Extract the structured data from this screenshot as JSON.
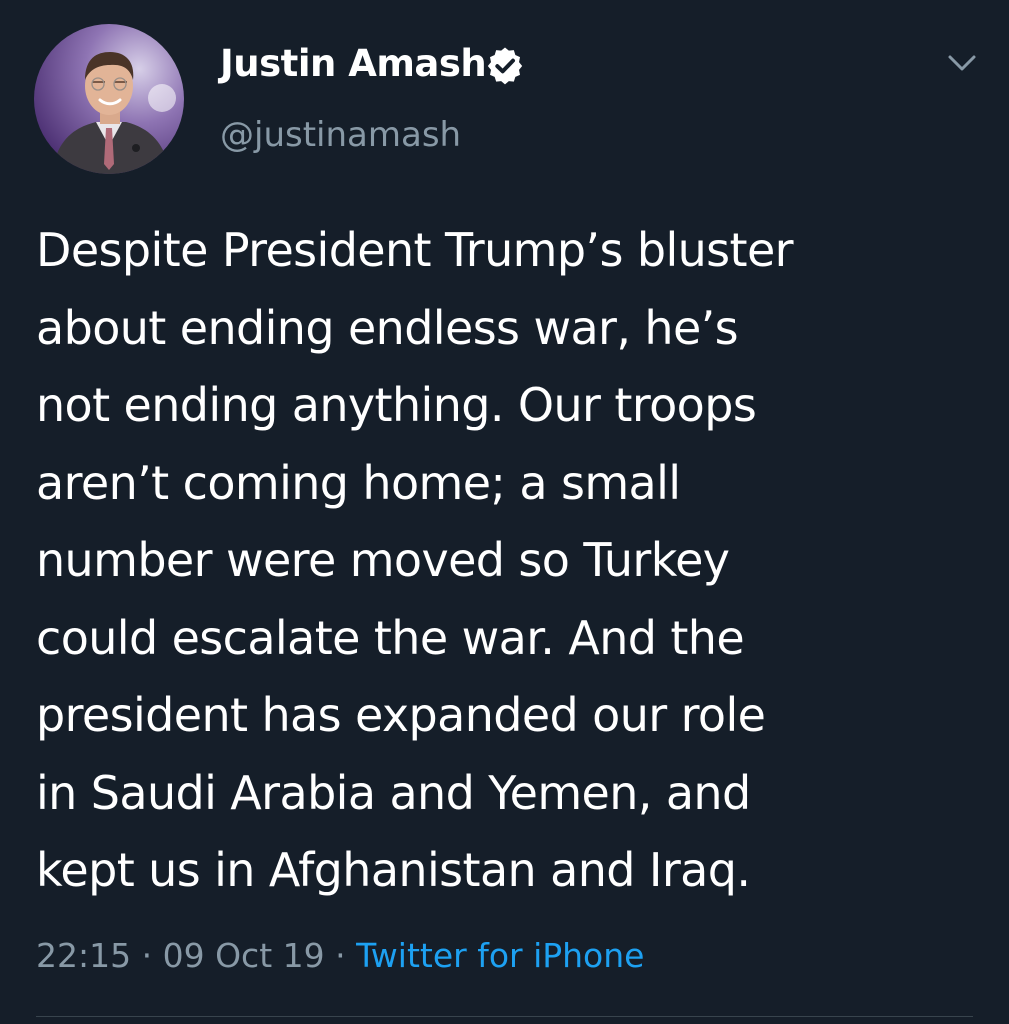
{
  "tweet": {
    "author": {
      "display_name": "Justin Amash",
      "handle": "@justinamash",
      "verified": true
    },
    "text": "Despite President Trump’s bluster\nabout ending endless war, he’s\nnot ending anything. Our troops\naren’t coming home; a small\nnumber were moved so Turkey\ncould escalate the war. And the\npresident has expanded our role\nin Saudi Arabia and Yemen, and\nkept us in Afghanistan and Iraq.",
    "meta": {
      "time": "22:15",
      "date": "09 Oct 19",
      "separator": " · ",
      "source": "Twitter for iPhone"
    }
  },
  "icons": {
    "verified": "verified-badge-icon",
    "menu": "chevron-down-icon"
  },
  "colors": {
    "background": "#151e29",
    "text": "#ffffff",
    "secondary_text": "#8899a6",
    "link": "#1da1f2",
    "divider": "#38444d"
  }
}
